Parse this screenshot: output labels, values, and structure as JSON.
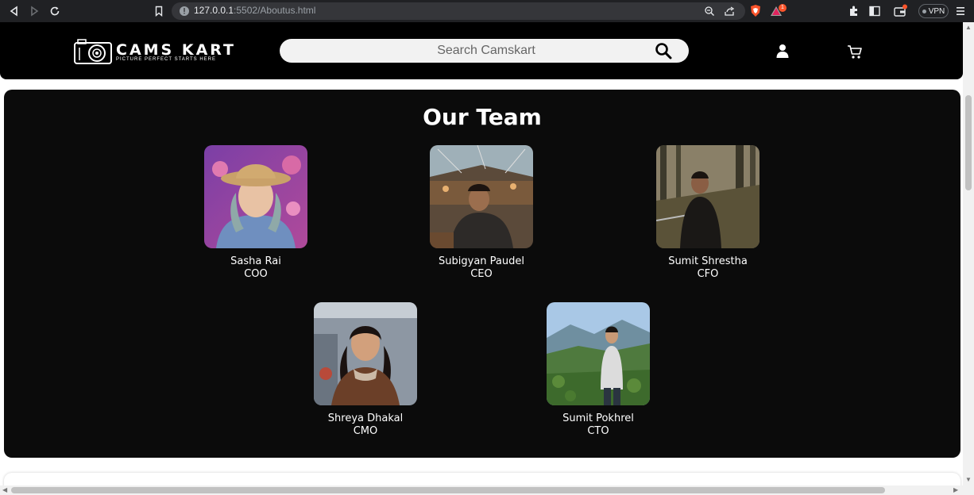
{
  "browser": {
    "url_host": "127.0.0.1",
    "url_rest": ":5502/Aboutus.html",
    "vpn_label": "VPN",
    "notification_count": "1"
  },
  "header": {
    "logo_title": "CAMS KART",
    "logo_tagline": "PICTURE PERFECT STARTS HERE",
    "search_placeholder": "Search Camskart"
  },
  "team": {
    "title": "Our Team",
    "members": [
      {
        "name": "Sasha Rai",
        "role": "COO"
      },
      {
        "name": "Subigyan Paudel",
        "role": "CEO"
      },
      {
        "name": "Sumit Shrestha",
        "role": "CFO"
      },
      {
        "name": "Shreya Dhakal",
        "role": "CMO"
      },
      {
        "name": "Sumit Pokhrel",
        "role": "CTO"
      }
    ]
  },
  "colors": {
    "header_bg": "#000000",
    "team_bg": "#0b0b0b",
    "text": "#ffffff",
    "search_bg": "#f2f2f2"
  }
}
